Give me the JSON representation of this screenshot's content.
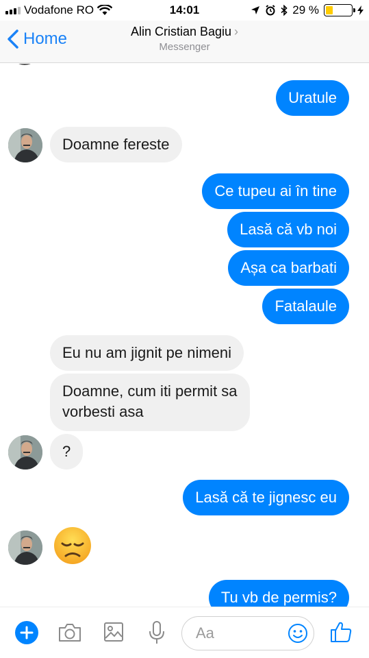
{
  "status": {
    "carrier": "Vodafone RO",
    "time": "14:01",
    "battery": "29 %",
    "battery_level": 0.29
  },
  "nav": {
    "back_label": "Home",
    "contact_name": "Alin Cristian Bagiu",
    "subtitle": "Messenger"
  },
  "messages": [
    {
      "side": "out",
      "text": "Uratule"
    },
    {
      "side": "in",
      "text": "Doamne fereste"
    },
    {
      "side": "out",
      "text": "Ce tupeu ai în tine"
    },
    {
      "side": "out",
      "text": "Lasă că vb noi"
    },
    {
      "side": "out",
      "text": "Așa ca barbati"
    },
    {
      "side": "out",
      "text": "Fatalaule"
    },
    {
      "side": "in",
      "text": "Eu nu am jignit pe nimeni"
    },
    {
      "side": "in",
      "text": "Doamne, cum iti permit sa\nvorbesti asa"
    },
    {
      "side": "in",
      "text": "?"
    },
    {
      "side": "out",
      "text": "Lasă că te jignesc eu"
    },
    {
      "side": "in",
      "emoji": "disappointed-face"
    },
    {
      "side": "out",
      "text": "Tu vb de permis?"
    }
  ],
  "composer": {
    "placeholder": "Aa"
  },
  "colors": {
    "accent": "#0084ff",
    "incoming_bubble": "#f0f0f0",
    "battery": "#ffcc00"
  }
}
